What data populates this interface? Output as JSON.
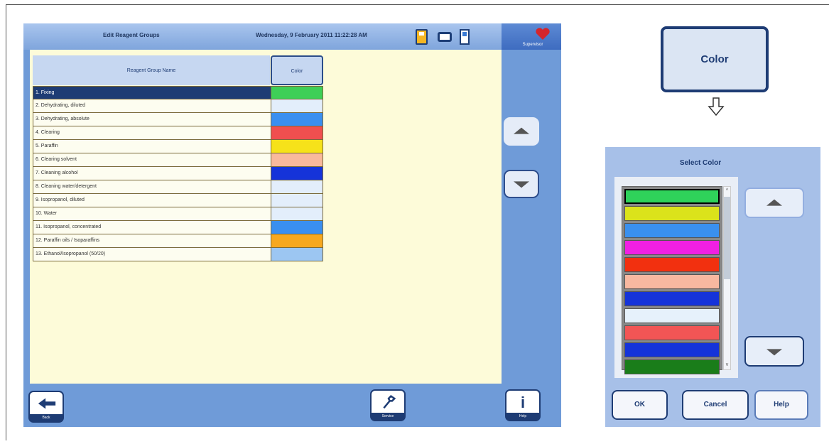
{
  "main": {
    "title": "Edit Reagent Groups",
    "datetime": "Wednesday, 9 February 2011 11:22:28 AM",
    "user": "Supervisor",
    "header_name": "Reagent Group Name",
    "header_color": "Color",
    "rows": [
      {
        "label": "1. Fixing",
        "color": "#3ecf57"
      },
      {
        "label": "2. Dehydrating, diluted",
        "color": "#e3eefb"
      },
      {
        "label": "3. Dehydrating, absolute",
        "color": "#3a8ff0"
      },
      {
        "label": "4. Clearing",
        "color": "#f04f4f"
      },
      {
        "label": "5. Paraffin",
        "color": "#f6e21a"
      },
      {
        "label": "6. Clearing solvent",
        "color": "#f9b99c"
      },
      {
        "label": "7. Cleaning alcohol",
        "color": "#1533d9"
      },
      {
        "label": "8. Cleaning water/detergent",
        "color": "#e3eefb"
      },
      {
        "label": "9. Isopropanol, diluted",
        "color": "#e3eefb"
      },
      {
        "label": "10. Water",
        "color": "#e3eefb"
      },
      {
        "label": "11. Isopropanol, concentrated",
        "color": "#3a8ff0"
      },
      {
        "label": "12. Paraffin oils / Isoparaffins",
        "color": "#f7a81e"
      },
      {
        "label": "13. Ethanol/Isopropanol (50/20)",
        "color": "#9cc6f2"
      }
    ],
    "footer": {
      "back": "Back",
      "service": "Service",
      "help": "Help"
    }
  },
  "callout": {
    "color_button": "Color"
  },
  "dialog": {
    "title": "Select Color",
    "swatches": [
      "#2fd25a",
      "#dbe31b",
      "#3a90ef",
      "#f020e3",
      "#f2300f",
      "#f8b8a0",
      "#1533d9",
      "#e6f1fb",
      "#f25555",
      "#1533d9",
      "#1a7d1a"
    ],
    "ok": "OK",
    "cancel": "Cancel",
    "help": "Help"
  }
}
